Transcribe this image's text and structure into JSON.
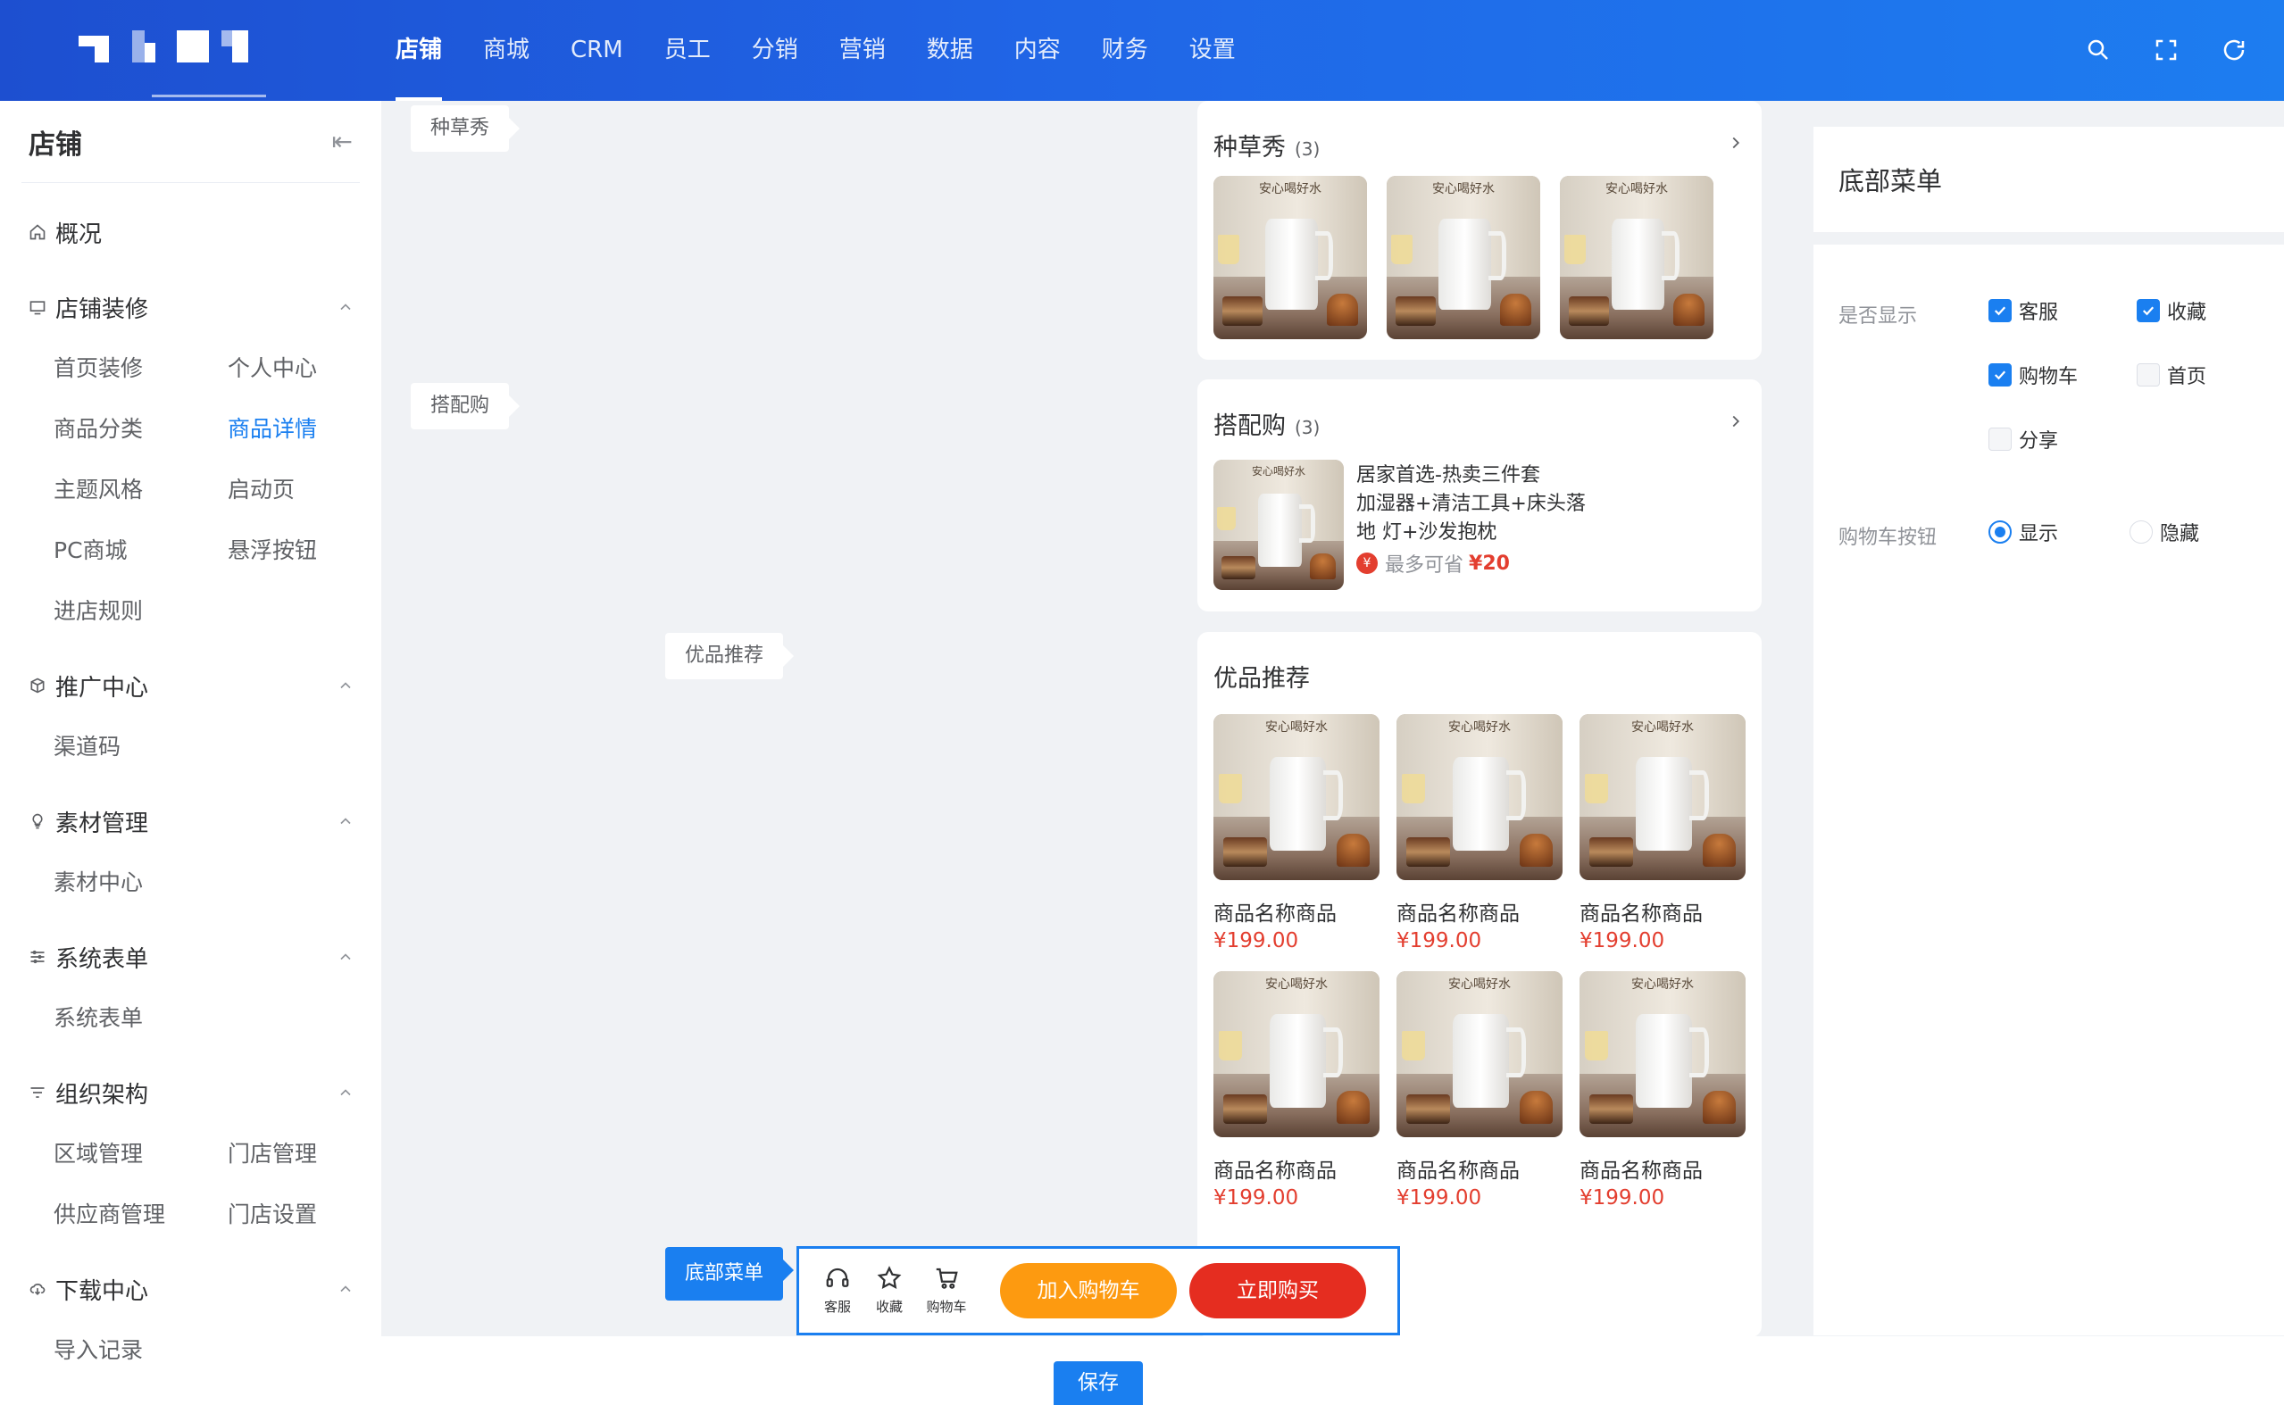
{
  "colors": {
    "primary": "#1a7ff0",
    "nav_bg": "#2065e6",
    "price": "#e33e2f",
    "cart_button": "#fd9a10",
    "buy_button": "#e52d20"
  },
  "nav": {
    "items": [
      "店铺",
      "商城",
      "CRM",
      "员工",
      "分销",
      "营销",
      "数据",
      "内容",
      "财务",
      "设置"
    ],
    "active": "店铺",
    "icons": [
      "search-icon",
      "fullscreen-icon",
      "refresh-icon"
    ]
  },
  "sidebar": {
    "title": "店铺",
    "collapse_icon": "collapse-left-icon",
    "overview": "概况",
    "groups": [
      {
        "label": "店铺装修",
        "icon": "monitor-icon",
        "items": [
          "首页装修",
          "个人中心",
          "商品分类",
          "商品详情",
          "主题风格",
          "启动页",
          "PC商城",
          "悬浮按钮",
          "进店规则"
        ],
        "active_item": "商品详情"
      },
      {
        "label": "推广中心",
        "icon": "cube-icon",
        "items": [
          "渠道码"
        ]
      },
      {
        "label": "素材管理",
        "icon": "bulb-icon",
        "items": [
          "素材中心"
        ]
      },
      {
        "label": "系统表单",
        "icon": "sliders-icon",
        "items": [
          "系统表单"
        ]
      },
      {
        "label": "组织架构",
        "icon": "filter-icon",
        "items": [
          "区域管理",
          "门店管理",
          "供应商管理",
          "门店设置"
        ]
      },
      {
        "label": "下载中心",
        "icon": "cloud-download-icon",
        "items": [
          "导入记录"
        ]
      }
    ]
  },
  "editor": {
    "tags": {
      "seed": "种草秀",
      "combo": "搭配购",
      "recommend": "优品推荐",
      "bottom_menu": "底部菜单"
    },
    "seed_card": {
      "title": "种草秀",
      "count": "(3)"
    },
    "combo_card": {
      "title": "搭配购",
      "count": "(3)",
      "product_line1": "居家首选-热卖三件套",
      "product_line2": "加湿器+清洁工具+床头落",
      "product_line3": "地 灯+沙发抱枕",
      "save_icon": "¥",
      "save_label": "最多可省",
      "save_value": "¥20"
    },
    "recommend_card": {
      "title": "优品推荐",
      "products": [
        {
          "name": "商品名称商品",
          "price": "¥199.00"
        },
        {
          "name": "商品名称商品",
          "price": "¥199.00"
        },
        {
          "name": "商品名称商品",
          "price": "¥199.00"
        },
        {
          "name": "商品名称商品",
          "price": "¥199.00"
        },
        {
          "name": "商品名称商品",
          "price": "¥199.00"
        },
        {
          "name": "商品名称商品",
          "price": "¥199.00"
        }
      ]
    },
    "thumb_heading": "安心喝好水",
    "bottom_bar": {
      "service": "客服",
      "favorite": "收藏",
      "cart": "购物车",
      "add_to_cart": "加入购物车",
      "buy_now": "立即购买"
    }
  },
  "right_panel": {
    "title": "底部菜单",
    "show_label": "是否显示",
    "checkboxes": [
      {
        "label": "客服",
        "checked": true
      },
      {
        "label": "收藏",
        "checked": true
      },
      {
        "label": "购物车",
        "checked": true
      },
      {
        "label": "首页",
        "checked": false
      },
      {
        "label": "分享",
        "checked": false
      }
    ],
    "cart_button_label": "购物车按钮",
    "radios": [
      {
        "label": "显示",
        "selected": true
      },
      {
        "label": "隐藏",
        "selected": false
      }
    ]
  },
  "footer": {
    "save": "保存"
  }
}
